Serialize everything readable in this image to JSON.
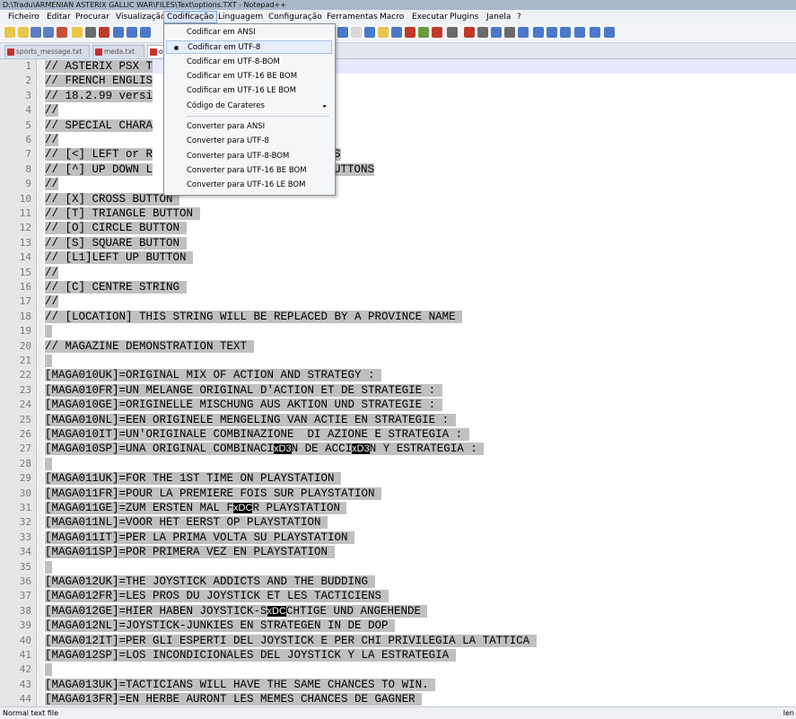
{
  "window": {
    "title": "D:\\Tradu\\ARMENIAN ASTERIX GALLIC WAR\\FILES\\Text\\options.TXT - Notepad++"
  },
  "menubar": [
    "Ficheiro",
    "Editar",
    "Procurar",
    "Visualização",
    "Codificação",
    "Linguagem",
    "Configuração",
    "Ferramentas",
    "Macro",
    "Executar",
    "Plugins",
    "Janela",
    "?"
  ],
  "tabs": [
    {
      "label": "sports_message.txt"
    },
    {
      "label": "meda.txt"
    },
    {
      "label": "o"
    }
  ],
  "encoding_menu": {
    "items": [
      {
        "label": "Codificar em ANSI"
      },
      {
        "label": "Codificar em UTF-8",
        "checked": true
      },
      {
        "label": "Codificar em UTF-8-BOM"
      },
      {
        "label": "Codificar em UTF-16 BE BOM"
      },
      {
        "label": "Codificar em UTF-16 LE BOM"
      },
      {
        "label": "Código de Carateres",
        "submenu": true
      },
      {
        "label": "Converter para ANSI"
      },
      {
        "label": "Converter para UTF-8"
      },
      {
        "label": "Converter para UTF-8-BOM"
      },
      {
        "label": "Converter para UTF-16 BE BOM"
      },
      {
        "label": "Converter para UTF-16 LE BOM"
      }
    ],
    "submenu_arrow": "▸"
  },
  "editor": {
    "lines": [
      {
        "n": "1",
        "segs": [
          {
            "t": "// ASTERIX PSX T"
          }
        ]
      },
      {
        "n": "2",
        "segs": [
          {
            "t": "// FRENCH ENGLIS"
          }
        ]
      },
      {
        "n": "3",
        "segs": [
          {
            "t": "// 18.2.99 versi"
          }
        ]
      },
      {
        "n": "4",
        "segs": [
          {
            "t": "//"
          }
        ]
      },
      {
        "n": "5",
        "segs": [
          {
            "t": "// SPECIAL CHARA"
          }
        ]
      },
      {
        "n": "6",
        "segs": [
          {
            "t": "//"
          }
        ]
      },
      {
        "n": "7",
        "segs": [
          {
            "t": "// [<] LEFT or R"
          }
        ]
      },
      {
        "n": "8",
        "segs": [
          {
            "t": "// [^] UP DOWN L"
          }
        ]
      },
      {
        "n": "9",
        "segs": [
          {
            "t": "//"
          }
        ]
      },
      {
        "n": "10",
        "segs": [
          {
            "t": "// [X] CROSS BUTTON "
          }
        ]
      },
      {
        "n": "11",
        "segs": [
          {
            "t": "// [T] TRIANGLE BUTTON "
          }
        ]
      },
      {
        "n": "12",
        "segs": [
          {
            "t": "// [O] CIRCLE BUTTON "
          }
        ]
      },
      {
        "n": "13",
        "segs": [
          {
            "t": "// [S] SQUARE BUTTON "
          }
        ]
      },
      {
        "n": "14",
        "segs": [
          {
            "t": "// [L1]LEFT UP BUTTON "
          }
        ]
      },
      {
        "n": "15",
        "segs": [
          {
            "t": "//"
          }
        ]
      },
      {
        "n": "16",
        "segs": [
          {
            "t": "// [C] CENTRE STRING "
          }
        ]
      },
      {
        "n": "17",
        "segs": [
          {
            "t": "//"
          }
        ]
      },
      {
        "n": "18",
        "segs": [
          {
            "t": "// [LOCATION] THIS STRING WILL BE REPLACED BY A PROVINCE NAME "
          }
        ]
      },
      {
        "n": "19",
        "segs": [
          {
            "t": " "
          }
        ]
      },
      {
        "n": "20",
        "segs": [
          {
            "t": "// MAGAZINE DEMONSTRATION TEXT "
          }
        ]
      },
      {
        "n": "21",
        "segs": [
          {
            "t": " "
          }
        ]
      },
      {
        "n": "22",
        "segs": [
          {
            "t": "[MAGA010UK]=ORIGINAL MIX OF ACTION AND STRATEGY : "
          }
        ]
      },
      {
        "n": "23",
        "segs": [
          {
            "t": "[MAGA010FR]=UN MELANGE ORIGINAL D'ACTION ET DE STRATEGIE : "
          }
        ]
      },
      {
        "n": "24",
        "segs": [
          {
            "t": "[MAGA010GE]=ORIGINELLE MISCHUNG AUS AKTION UND STRATEGIE : "
          }
        ]
      },
      {
        "n": "25",
        "segs": [
          {
            "t": "[MAGA010NL]=EEN ORIGINELE MENGELING VAN ACTIE EN STRATEGIE : "
          }
        ]
      },
      {
        "n": "26",
        "segs": [
          {
            "t": "[MAGA010IT]=UN'ORIGINALE COMBINAZIONE  DI AZIONE E STRATEGIA : "
          }
        ]
      },
      {
        "n": "27",
        "segs": [
          {
            "t": "[MAGA010SP]=UNA ORIGINAL COMBINACI"
          },
          {
            "c": "xD3"
          },
          {
            "t": "N DE ACCI"
          },
          {
            "c": "xD3"
          },
          {
            "t": "N Y ESTRATEGIA : "
          }
        ]
      },
      {
        "n": "28",
        "segs": [
          {
            "t": " "
          }
        ]
      },
      {
        "n": "29",
        "segs": [
          {
            "t": "[MAGA011UK]=FOR THE 1ST TIME ON PLAYSTATION "
          }
        ]
      },
      {
        "n": "30",
        "segs": [
          {
            "t": "[MAGA011FR]=POUR LA PREMIERE FOIS SUR PLAYSTATION "
          }
        ]
      },
      {
        "n": "31",
        "segs": [
          {
            "t": "[MAGA011GE]=ZUM ERSTEN MAL F"
          },
          {
            "c": "xDC"
          },
          {
            "t": "R PLAYSTATION "
          }
        ]
      },
      {
        "n": "32",
        "segs": [
          {
            "t": "[MAGA011NL]=VOOR HET EERST OP PLAYSTATION "
          }
        ]
      },
      {
        "n": "33",
        "segs": [
          {
            "t": "[MAGA011IT]=PER LA PRIMA VOLTA SU PLAYSTATION "
          }
        ]
      },
      {
        "n": "34",
        "segs": [
          {
            "t": "[MAGA011SP]=POR PRIMERA VEZ EN PLAYSTATION "
          }
        ]
      },
      {
        "n": "35",
        "segs": [
          {
            "t": " "
          }
        ]
      },
      {
        "n": "36",
        "segs": [
          {
            "t": "[MAGA012UK]=THE JOYSTICK ADDICTS AND THE BUDDING "
          }
        ]
      },
      {
        "n": "37",
        "segs": [
          {
            "t": "[MAGA012FR]=LES PROS DU JOYSTICK ET LES TACTICIENS "
          }
        ]
      },
      {
        "n": "38",
        "segs": [
          {
            "t": "[MAGA012GE]=HIER HABEN JOYSTICK-S"
          },
          {
            "c": "xDC"
          },
          {
            "t": "CHTIGE UND ANGEHENDE "
          }
        ]
      },
      {
        "n": "39",
        "segs": [
          {
            "t": "[MAGA012NL]=JOYSTICK-JUNKIES EN STRATEGEN IN DE DOP "
          }
        ]
      },
      {
        "n": "40",
        "segs": [
          {
            "t": "[MAGA012IT]=PER GLI ESPERTI DEL JOYSTICK E PER CHI PRIVILEGIA LA TATTICA "
          }
        ]
      },
      {
        "n": "41",
        "segs": [
          {
            "t": "[MAGA012SP]=LOS INCONDICIONALES DEL JOYSTICK Y LA ESTRATEGIA "
          }
        ]
      },
      {
        "n": "42",
        "segs": [
          {
            "t": " "
          }
        ]
      },
      {
        "n": "43",
        "segs": [
          {
            "t": "[MAGA013UK]=TACTICIANS WILL HAVE THE SAME CHANCES TO WIN. "
          }
        ]
      },
      {
        "n": "44",
        "segs": [
          {
            "t": "[MAGA013FR]=EN HERBE AURONT LES MEMES CHANCES DE GAGNER "
          }
        ]
      }
    ],
    "line8_tail": "UTTONS",
    "line7_tail": "S"
  },
  "statusbar": {
    "left": "Normal text file",
    "right": "len"
  }
}
